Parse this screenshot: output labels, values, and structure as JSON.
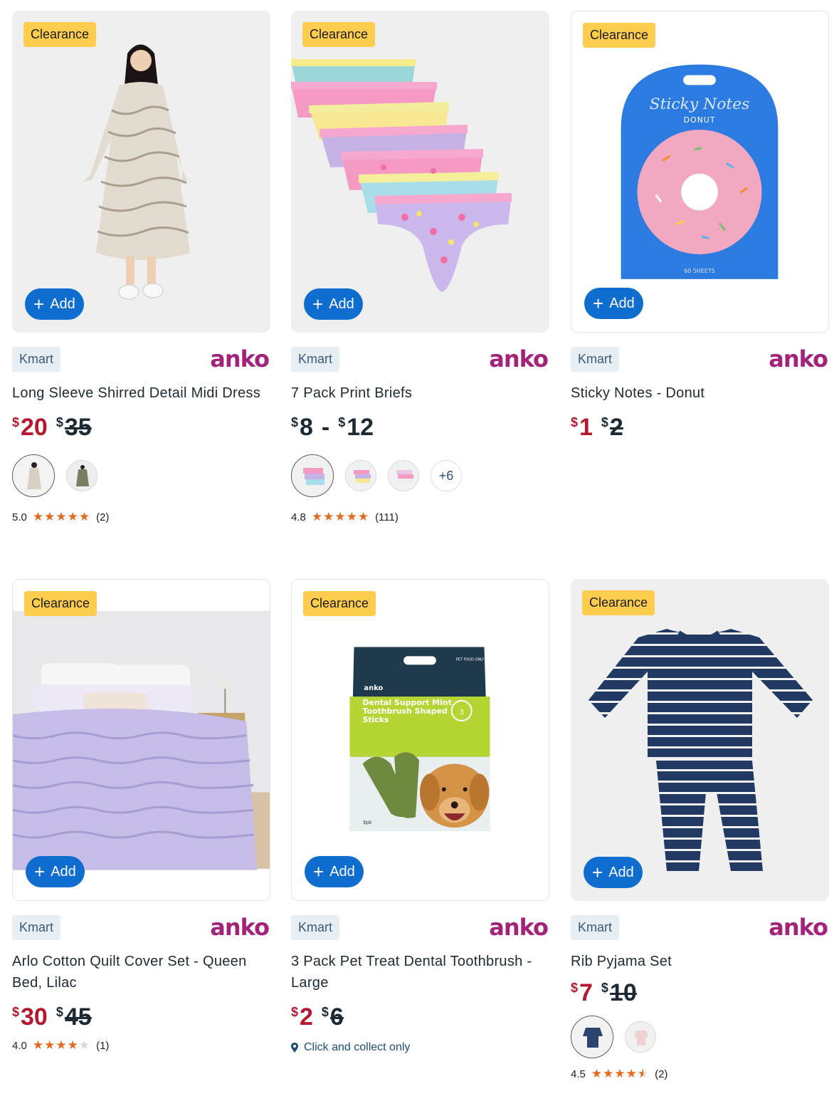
{
  "badge_label": "Clearance",
  "add_label": "Add",
  "store_chip": "Kmart",
  "brand": "anko",
  "colors": {
    "badge": "#ffcd4d",
    "add_button": "#0f6dcf",
    "sale_price": "#b5172e",
    "brand": "#a3227a",
    "stars": "#e36a1e"
  },
  "products": [
    {
      "title": "Long Sleeve Shirred Detail Midi Dress",
      "price_now": "20",
      "price_was": "35",
      "swatches_more": "",
      "rating": "5.0",
      "reviews": "(2)",
      "stars": 5
    },
    {
      "title": "7 Pack Print Briefs",
      "price_low": "8",
      "price_high": "12",
      "swatches_more": "+6",
      "rating": "4.8",
      "reviews": "(111)",
      "stars": 5
    },
    {
      "title": "Sticky Notes - Donut",
      "price_now": "1",
      "price_was": "2"
    },
    {
      "title": "Arlo Cotton Quilt Cover Set - Queen Bed, Lilac",
      "price_now": "30",
      "price_was": "45",
      "rating": "4.0",
      "reviews": "(1)",
      "stars": 4
    },
    {
      "title": "3 Pack Pet Treat Dental Toothbrush - Large",
      "price_now": "2",
      "price_was": "6",
      "collect": "Click and collect only"
    },
    {
      "title": "Rib Pyjama Set",
      "price_now": "7",
      "price_was": "10",
      "rating": "4.5",
      "reviews": "(2)",
      "stars": 4.5
    }
  ],
  "product_art_text": {
    "sticky_title": "Sticky Notes",
    "sticky_sub": "DONUT",
    "sticky_sheets": "60 SHEETS",
    "pet_brand": "anko",
    "pet_title": "Dental Support Mint Toothbrush Shaped Sticks",
    "pet_pack": "3pk",
    "pet_only": "PET FOOD ONLY"
  }
}
